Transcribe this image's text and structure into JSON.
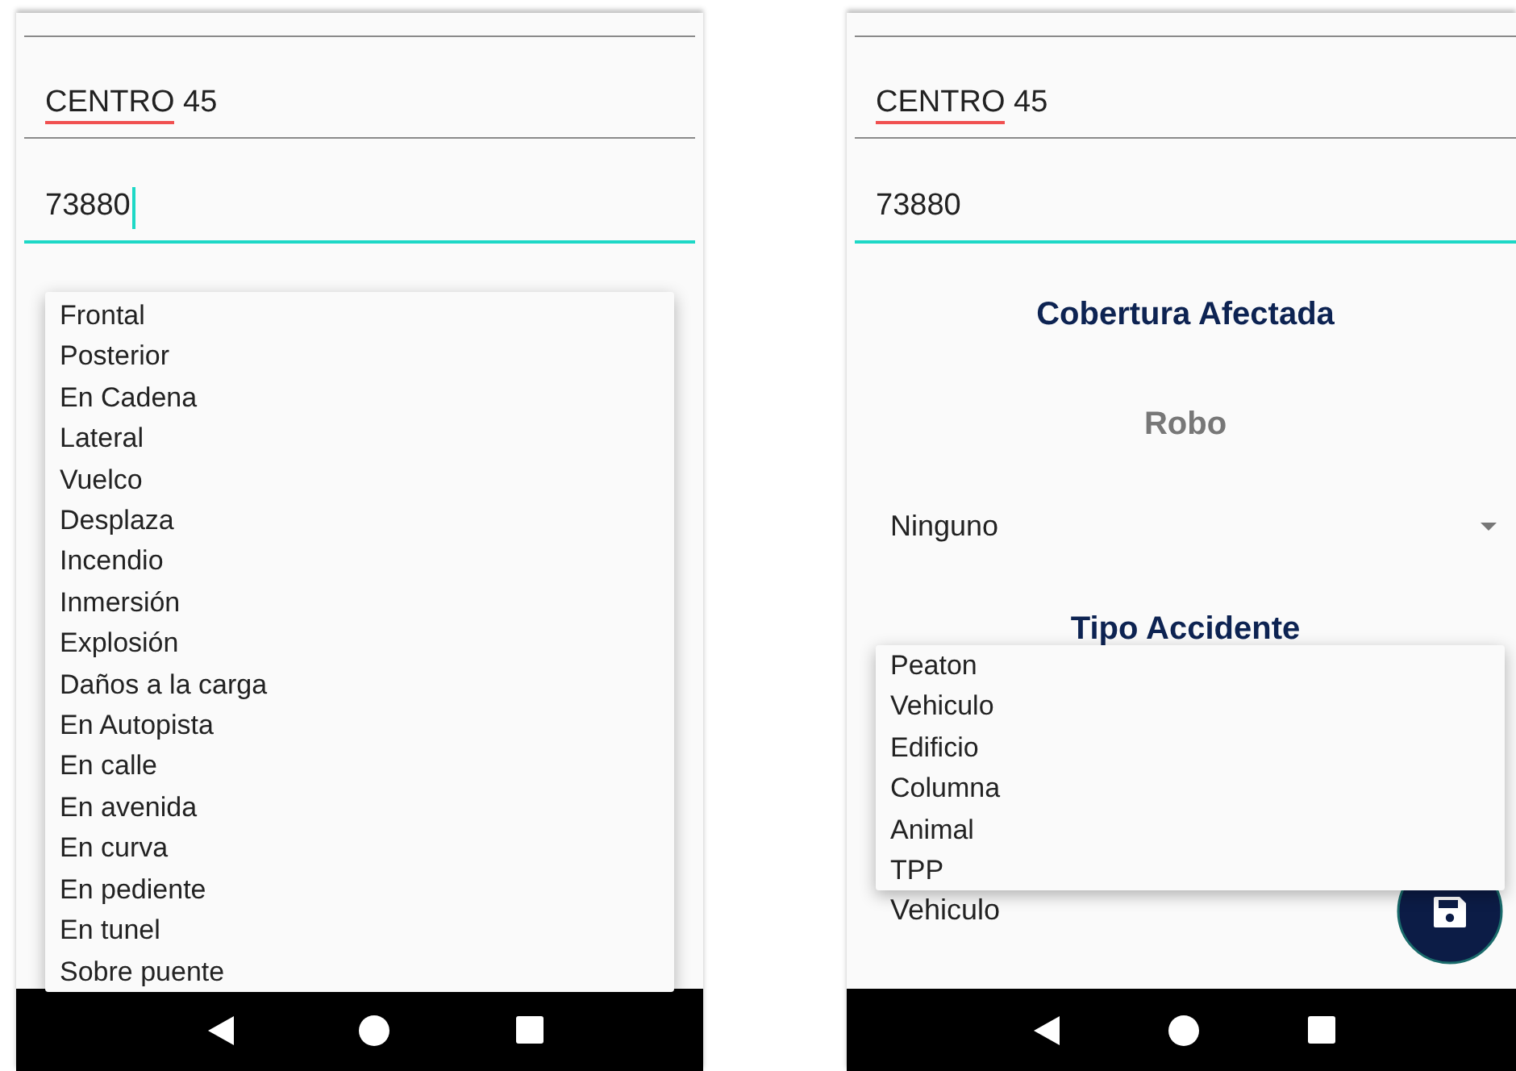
{
  "screens": [
    {
      "form": [
        {
          "kind": "field",
          "value": "CENTRO 45",
          "spelling_error": true,
          "focused": false,
          "cursor": false
        },
        {
          "kind": "field",
          "value": "73880",
          "spelling_error": false,
          "focused": true,
          "cursor": true
        }
      ],
      "dropdown": {
        "kind": "long",
        "options": [
          "Frontal",
          "Posterior",
          "En Cadena",
          "Lateral",
          "Vuelco",
          "Desplaza",
          "Incendio",
          "Inmersión",
          "Explosión",
          "Daños a la carga",
          "En Autopista",
          "En calle",
          "En avenida",
          "En curva",
          "En pediente",
          "En tunel",
          "Sobre puente"
        ]
      },
      "fab": false
    },
    {
      "form": [
        {
          "kind": "field",
          "value": "CENTRO 45",
          "spelling_error": true,
          "focused": false,
          "cursor": false
        },
        {
          "kind": "field",
          "value": "73880",
          "spelling_error": false,
          "focused": true,
          "cursor": false
        },
        {
          "kind": "heading",
          "text": "Cobertura Afectada"
        },
        {
          "kind": "subheading",
          "text": "Robo"
        },
        {
          "kind": "select",
          "value": "Ninguno",
          "arrow": true
        },
        {
          "kind": "heading",
          "text": "Tipo Accidente"
        },
        {
          "kind": "select",
          "value": "Vehiculo",
          "arrow": false
        }
      ],
      "dropdown": {
        "kind": "short",
        "options": [
          "Peaton",
          "Vehiculo",
          "Edificio",
          "Columna",
          "Animal",
          "TPP"
        ]
      },
      "fab": true
    }
  ]
}
